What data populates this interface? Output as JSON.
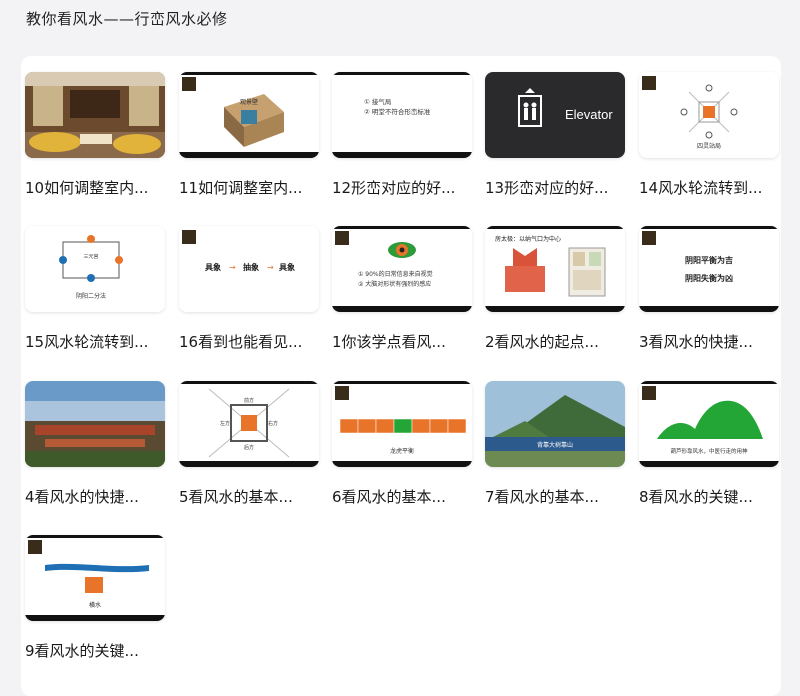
{
  "page": {
    "title": "教你看风水——行峦风水必修"
  },
  "thumbnail_text": {
    "elevator": "Elevator",
    "t11": "观景壁",
    "t12_line1": "① 接气局",
    "t12_line2": "② 明堂不符合形峦标准",
    "t14_label": "四灵站局",
    "t15_label": "阴阳二分法",
    "t15_center": "三元宫",
    "t16_a": "具象",
    "t16_b": "抽象",
    "t16_c": "具象",
    "t1_line1": "① 90%的日常信息来自视觉",
    "t1_line2": "② 大脑对形状有强烈的感应",
    "t2_title": "房太极：以纳气口为中心",
    "t3_line1": "阴阳平衡为吉",
    "t3_line2": "阴阳失衡为凶",
    "t5_top": "前方",
    "t5_bottom": "后方",
    "t5_left": "左方",
    "t5_right": "右方",
    "t6_label": "龙虎平衡",
    "t7_label": "背靠大树靠山",
    "t8_label": "葫芦形靠风水，中医行走的用神",
    "t9_label": "横水"
  },
  "colors": {
    "accent_orange": "#e8742a",
    "green": "#23a635",
    "blue_water": "#1f6fb5"
  },
  "cards": [
    {
      "title": "10如何调整室内...",
      "thumb": "living-room-image"
    },
    {
      "title": "11如何调整室内...",
      "thumb": "floorplan-3d"
    },
    {
      "title": "12形峦对应的好...",
      "thumb": "text-slide"
    },
    {
      "title": "13形峦对应的好...",
      "thumb": "elevator-sign"
    },
    {
      "title": "14风水轮流转到...",
      "thumb": "four-directions-diagram"
    },
    {
      "title": "15风水轮流转到...",
      "thumb": "yin-yang-diagram"
    },
    {
      "title": "16看到也能看见...",
      "thumb": "concrete-abstract-slide"
    },
    {
      "title": "1你该学点看风...",
      "thumb": "eye-slide"
    },
    {
      "title": "2看风水的起点...",
      "thumb": "house-taiji-slide"
    },
    {
      "title": "3看风水的快捷...",
      "thumb": "yin-yang-balance-slide"
    },
    {
      "title": "4看风水的快捷...",
      "thumb": "forbidden-city-image"
    },
    {
      "title": "5看风水的基本...",
      "thumb": "compass-diagram"
    },
    {
      "title": "6看风水的基本...",
      "thumb": "dragon-tiger-bar"
    },
    {
      "title": "7看风水的基本...",
      "thumb": "blue-house-image"
    },
    {
      "title": "8看风水的关键...",
      "thumb": "green-hills-slide"
    },
    {
      "title": "9看风水的关键...",
      "thumb": "water-line-slide"
    }
  ]
}
